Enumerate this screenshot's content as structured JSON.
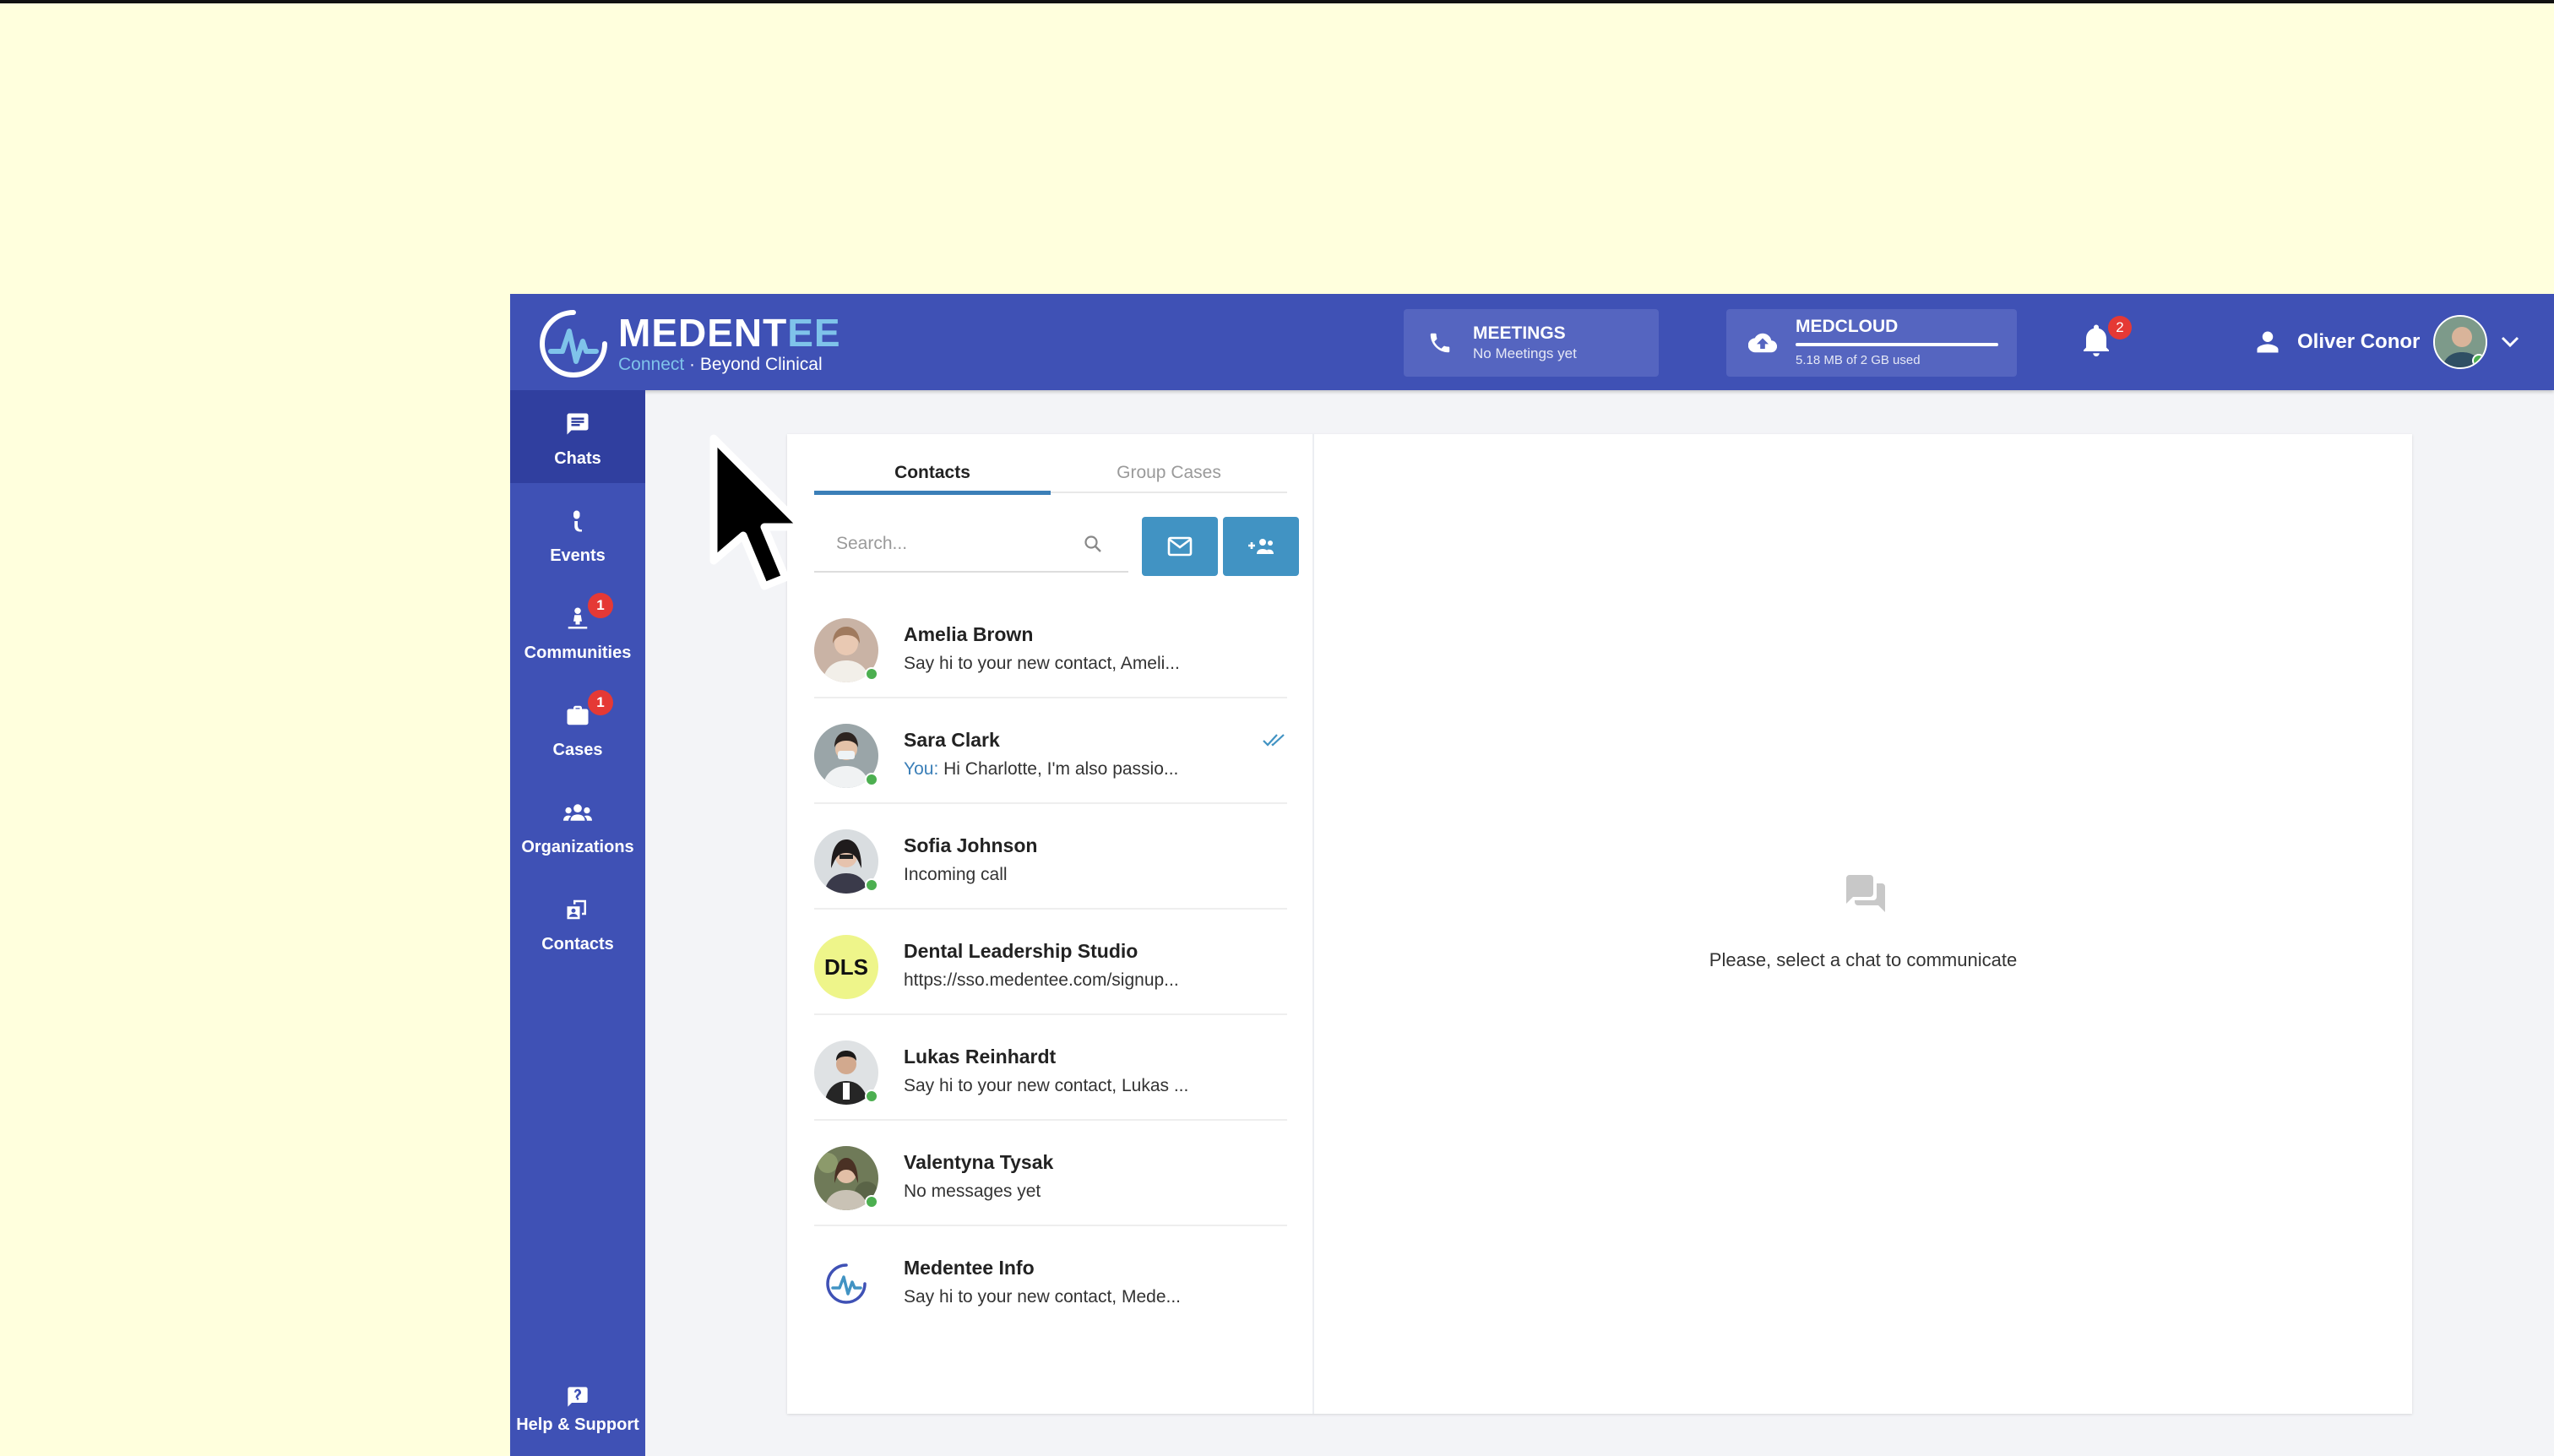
{
  "header": {
    "logo_name_main": "MEDENT",
    "logo_name_accent": "EE",
    "logo_tag_accent": "Connect",
    "logo_tag_rest": " · Beyond Clinical",
    "meetings_title": "MEETINGS",
    "meetings_sub": "No Meetings yet",
    "medcloud_title": "MEDCLOUD",
    "medcloud_sub": "5.18 MB of 2 GB used",
    "medcloud_usage_fraction": 0.0025,
    "notifications_count": "2",
    "user_name": "Oliver Conor",
    "icons": [
      "phone-icon",
      "cloud-upload-icon",
      "bell-icon",
      "person-icon",
      "chevron-down-icon"
    ]
  },
  "sidebar": {
    "items": [
      {
        "label": "Chats",
        "icon": "chat-icon",
        "active": true,
        "badge": ""
      },
      {
        "label": "Events",
        "icon": "microphone-icon",
        "active": false,
        "badge": ""
      },
      {
        "label": "Communities",
        "icon": "community-icon",
        "active": false,
        "badge": "1"
      },
      {
        "label": "Cases",
        "icon": "briefcase-icon",
        "active": false,
        "badge": "1"
      },
      {
        "label": "Organizations",
        "icon": "groups-icon",
        "active": false,
        "badge": ""
      },
      {
        "label": "Contacts",
        "icon": "contact-card-icon",
        "active": false,
        "badge": ""
      }
    ],
    "help_label": "Help & Support"
  },
  "tabs": {
    "contacts": "Contacts",
    "group_cases": "Group Cases"
  },
  "search": {
    "placeholder": "Search..."
  },
  "contacts": [
    {
      "name": "Amelia Brown",
      "message": "Say hi to your new contact, Ameli...",
      "you_prefix": "",
      "online": true,
      "read": false
    },
    {
      "name": "Sara Clark",
      "message": " Hi Charlotte, I'm also passio...",
      "you_prefix": "You:",
      "online": true,
      "read": true
    },
    {
      "name": "Sofia Johnson",
      "message": "Incoming call",
      "you_prefix": "",
      "online": true,
      "read": false
    },
    {
      "name": "Dental Leadership Studio",
      "message": "https://sso.medentee.com/signup...",
      "you_prefix": "",
      "online": false,
      "read": false,
      "initials": "DLS"
    },
    {
      "name": "Lukas Reinhardt",
      "message": "Say hi to your new contact, Lukas ...",
      "you_prefix": "",
      "online": true,
      "read": false
    },
    {
      "name": "Valentyna Tysak",
      "message": "No messages yet",
      "you_prefix": "",
      "online": true,
      "read": false
    },
    {
      "name": "Medentee Info",
      "message": "Say hi to your new contact, Mede...",
      "you_prefix": "",
      "online": false,
      "read": false
    }
  ],
  "empty_state": {
    "text": "Please, select a chat to communicate",
    "icon": "chat-bubbles-icon"
  },
  "colors": {
    "page_background": "#ffffdd",
    "brand_blue": "#3f51b5",
    "brand_blue_dark": "#303f9f",
    "accent_blue": "#4193c3",
    "badge_red": "#e53935",
    "online_green": "#4caf50"
  }
}
